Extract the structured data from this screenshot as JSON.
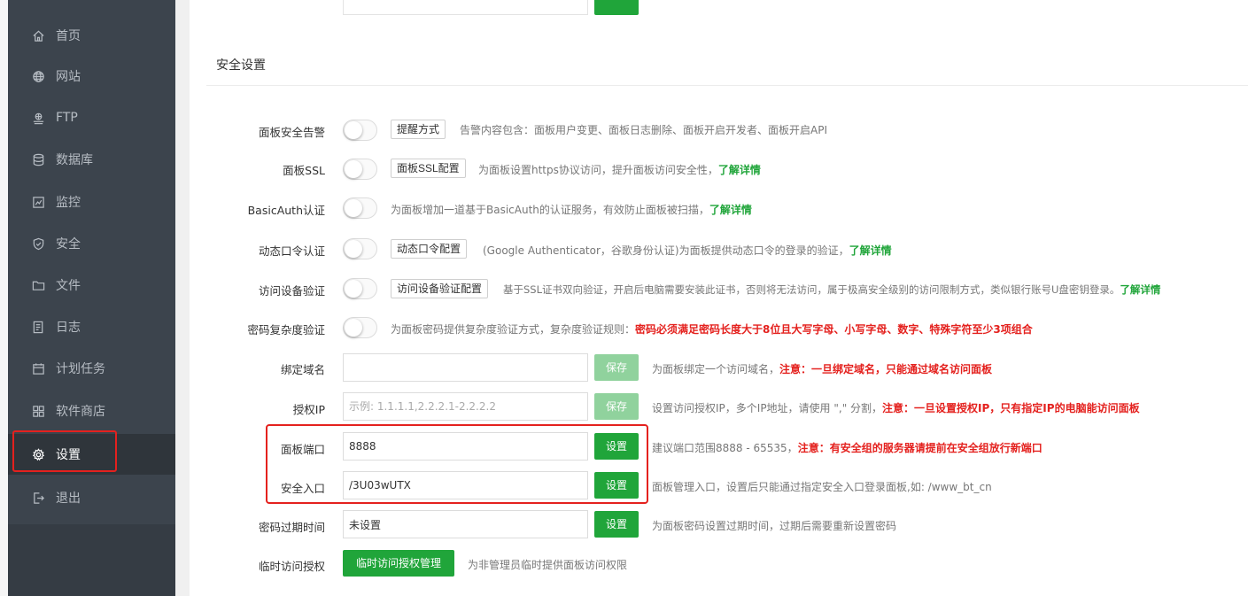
{
  "sidebar": {
    "items": [
      {
        "label": "首页",
        "icon": "home-icon"
      },
      {
        "label": "网站",
        "icon": "globe-icon"
      },
      {
        "label": "FTP",
        "icon": "ftp-icon"
      },
      {
        "label": "数据库",
        "icon": "database-icon"
      },
      {
        "label": "监控",
        "icon": "monitor-icon"
      },
      {
        "label": "安全",
        "icon": "shield-icon"
      },
      {
        "label": "文件",
        "icon": "folder-icon"
      },
      {
        "label": "日志",
        "icon": "log-icon"
      },
      {
        "label": "计划任务",
        "icon": "calendar-icon"
      },
      {
        "label": "软件商店",
        "icon": "apps-icon"
      },
      {
        "label": "设置",
        "icon": "gear-icon",
        "active": true
      },
      {
        "label": "退出",
        "icon": "logout-icon"
      }
    ]
  },
  "section": {
    "title": "安全设置"
  },
  "rows": {
    "alert": {
      "label": "面板安全告警",
      "button": "提醒方式",
      "desc": "告警内容包含：面板用户变更、面板日志删除、面板开启开发者、面板开启API"
    },
    "ssl": {
      "label": "面板SSL",
      "button": "面板SSL配置",
      "desc": "为面板设置https协议访问，提升面板访问安全性，",
      "link": "了解详情"
    },
    "basicauth": {
      "label": "BasicAuth认证",
      "desc": "为面板增加一道基于BasicAuth的认证服务，有效防止面板被扫描，",
      "link": "了解详情"
    },
    "totp": {
      "label": "动态口令认证",
      "button": "动态口令配置",
      "desc": "(Google Authenticator，谷歌身份认证)为面板提供动态口令的登录的验证，",
      "link": "了解详情"
    },
    "device": {
      "label": "访问设备验证",
      "button": "访问设备验证配置",
      "desc": "基于SSL证书双向验证，开启后电脑需要安装此证书，否则将无法访问，属于极高安全级别的访问限制方式，类似银行账号U盘密钥登录。",
      "link": "了解详情"
    },
    "complexity": {
      "label": "密码复杂度验证",
      "desc": "为面板密码提供复杂度验证方式，复杂度验证规则：",
      "warn": "密码必须满足密码长度大于8位且大写字母、小写字母、数字、特殊字符至少3项组合"
    },
    "domain": {
      "label": "绑定域名",
      "value": "",
      "button": "保存",
      "desc": "为面板绑定一个访问域名，",
      "warn": "注意：一旦绑定域名，只能通过域名访问面板"
    },
    "ip": {
      "label": "授权IP",
      "placeholder": "示例: 1.1.1.1,2.2.2.1-2.2.2.2",
      "button": "保存",
      "desc": "设置访问授权IP，多个IP地址，请使用 \",\" 分割，",
      "warn": "注意：一旦设置授权IP，只有指定IP的电脑能访问面板"
    },
    "port": {
      "label": "面板端口",
      "value": "8888",
      "button": "设置",
      "desc": "建议端口范围8888 - 65535，",
      "warn": "注意：有安全组的服务器请提前在安全组放行新端口"
    },
    "entry": {
      "label": "安全入口",
      "value": "/3U03wUTX",
      "button": "设置",
      "desc": "面板管理入口，设置后只能通过指定安全入口登录面板,如: /www_bt_cn"
    },
    "expire": {
      "label": "密码过期时间",
      "value": "未设置",
      "button": "设置",
      "desc": "为面板密码设置过期时间，过期后需要重新设置密码"
    },
    "temp": {
      "label": "临时访问授权",
      "button": "临时访问授权管理",
      "desc": "为非管理员临时提供面板访问权限"
    }
  },
  "colors": {
    "sidebar_bg": "#3c444d",
    "accent_green": "#20a53a",
    "warn_red": "#e4211e"
  }
}
